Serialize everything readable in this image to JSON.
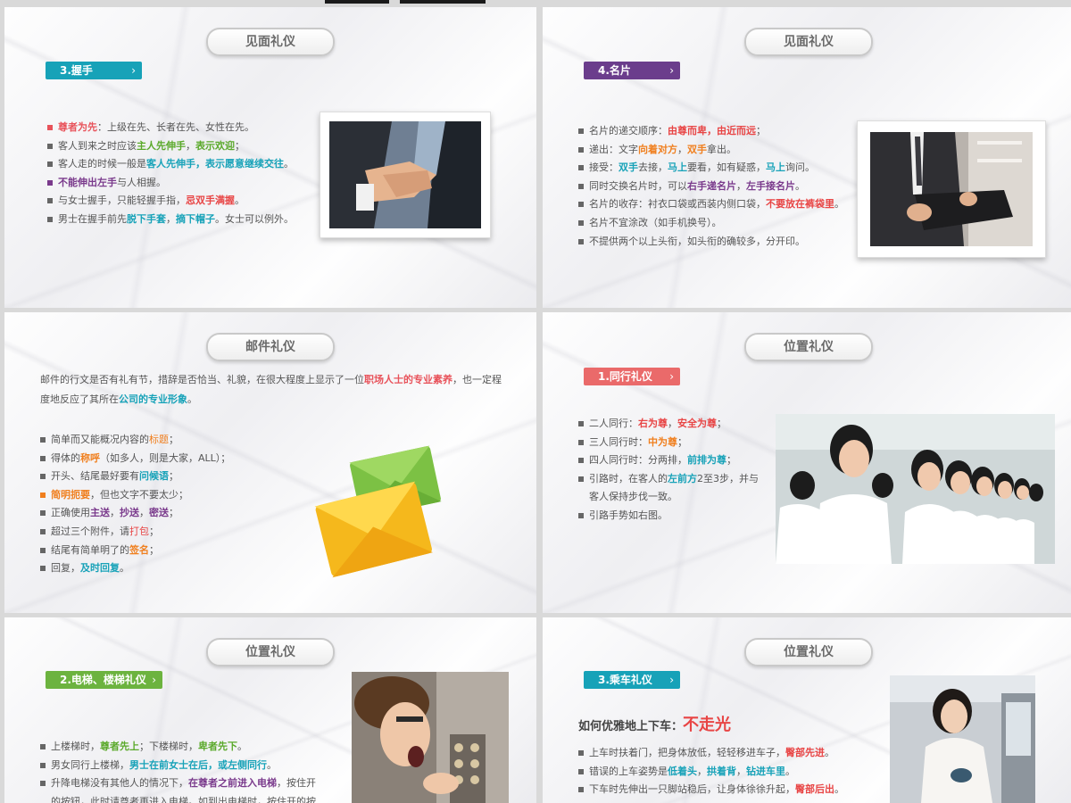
{
  "colors": {
    "teal": "#17a2b8",
    "purple": "#6b3d8c",
    "salmon": "#ea6a6a",
    "green": "#6cb33f",
    "red": "#e84545",
    "orange": "#f07f1e"
  },
  "slide1": {
    "title": "见面礼仪",
    "tag": "3.握手",
    "bullets": [
      {
        "pre": "",
        "hl1": "尊者为先",
        "mid": "：上级在先、长者在先、女性在先。",
        "hl2": "",
        "post": ""
      },
      {
        "pre": "客人到来之时应该",
        "hl1": "主人先伸手",
        "mid": "，",
        "hl2": "表示欢迎",
        "post": "；"
      },
      {
        "pre": "客人走的时候一般是",
        "hl1": "客人先伸手，表示愿意继续交往",
        "mid": "。",
        "hl2": "",
        "post": ""
      },
      {
        "pre": "",
        "hl1": "不能伸出左手",
        "mid": "与人相握。",
        "hl2": "",
        "post": ""
      },
      {
        "pre": "与女士握手，只能轻握手指，",
        "hl1": "忌双手满握",
        "mid": "。",
        "hl2": "",
        "post": ""
      },
      {
        "pre": "男士在握手前先",
        "hl1": "脱下手套",
        "mid": "，",
        "hl2": "摘下帽子",
        "post": "。女士可以例外。"
      }
    ],
    "image_icon": "handshake-photo"
  },
  "slide2": {
    "title": "见面礼仪",
    "tag": "4.名片",
    "bullets": [
      {
        "pre": "名片的递交顺序：",
        "hl1": "由尊而卑，由近而远",
        "mid": "；",
        "hl2": "",
        "post": ""
      },
      {
        "pre": "递出：文字",
        "hl1": "向着对方",
        "mid": "，",
        "hl2": "双手",
        "post": "拿出。"
      },
      {
        "pre": "接受：",
        "hl1": "双手",
        "mid": "去接，",
        "hl2": "马上",
        "post": "要看，如有疑惑，"
      },
      {
        "pre": "同时交换名片时，可以",
        "hl1": "右手递名片",
        "mid": "，",
        "hl2": "左手接名片",
        "post": "。"
      },
      {
        "pre": "名片的收存：衬衣口袋或西装内侧口袋，",
        "hl1": "不要放在裤袋里",
        "mid": "。",
        "hl2": "",
        "post": ""
      },
      {
        "pre": "名片不宜涂改（如手机换号）。",
        "hl1": "",
        "mid": "",
        "hl2": "",
        "post": ""
      },
      {
        "pre": "不提供两个以上头衔，如头衔的确较多，分开印。",
        "hl1": "",
        "mid": "",
        "hl2": "",
        "post": ""
      }
    ],
    "bullet3_tail_hl": "马上",
    "bullet3_tail_post": "询问。",
    "image_icon": "business-card-photo"
  },
  "slide3": {
    "title": "邮件礼仪",
    "para_pre": "邮件的行文是否有礼有节，措辞是否恰当、礼貌，在很大程度上显示了一位",
    "para_hl1": "职场人士的专业素养",
    "para_mid": "，也一定程度地反应了其所在",
    "para_hl2": "公司的专业形象",
    "para_post": "。",
    "bullets": [
      {
        "pre": "简单而又能概况内容的",
        "hl1": "标题",
        "mid": "；",
        "hl2": "",
        "post": ""
      },
      {
        "pre": "得体的",
        "hl1": "称呼",
        "mid": "（如多人，则是大家，ALL）；",
        "hl2": "",
        "post": ""
      },
      {
        "pre": "开头、结尾最好要有",
        "hl1": "问候语",
        "mid": "；",
        "hl2": "",
        "post": ""
      },
      {
        "pre": "",
        "hl1": "简明扼要",
        "mid": "，但也文字不要太少；",
        "hl2": "",
        "post": ""
      },
      {
        "pre": "正确使用",
        "hl1": "主送",
        "mid": "，",
        "hl2": "抄送",
        "post": "，"
      },
      {
        "pre": "超过三个附件，请",
        "hl1": "打包",
        "mid": "；",
        "hl2": "",
        "post": ""
      },
      {
        "pre": "结尾有简单明了的",
        "hl1": "签名",
        "mid": "；",
        "hl2": "",
        "post": ""
      },
      {
        "pre": "回复，",
        "hl1": "及时回复",
        "mid": "。",
        "hl2": "",
        "post": ""
      }
    ],
    "bullet5_tail_hl": "密送",
    "bullet5_tail_post": "；",
    "image_icon": "envelope-icon"
  },
  "slide4": {
    "title": "位置礼仪",
    "tag": "1.同行礼仪",
    "bullets": [
      {
        "pre": "二人同行：",
        "hl1": "右为尊",
        "mid": "，",
        "hl2": "安全为尊",
        "post": "；"
      },
      {
        "pre": "三人同行时：",
        "hl1": "中为尊",
        "mid": "；",
        "hl2": "",
        "post": ""
      },
      {
        "pre": "四人同行时：分两排，",
        "hl1": "前排为尊",
        "mid": "；",
        "hl2": "",
        "post": ""
      },
      {
        "pre": "引路时，在客人的",
        "hl1": "左前方",
        "mid": "2至3步，并与",
        "hl2": "",
        "post": ""
      },
      {
        "pre": "引路手势如右图。",
        "hl1": "",
        "mid": "",
        "hl2": "",
        "post": ""
      }
    ],
    "bullet4_cont": "客人保持步伐一致。",
    "image_icon": "hostesses-photo"
  },
  "slide5": {
    "title": "位置礼仪",
    "tag": "2.电梯、楼梯礼仪",
    "bullets": [
      {
        "pre": "上楼梯时，",
        "hl1": "尊者先上",
        "mid": "；下楼梯时，",
        "hl2": "卑者先下",
        "post": "。"
      },
      {
        "pre": "男女同行上楼梯，",
        "hl1": "男士在前女士在后，或左侧同行",
        "mid": "。",
        "hl2": "",
        "post": ""
      },
      {
        "pre": "升降电梯没有其他人的情况下，",
        "hl1": "在尊者之前进入电梯",
        "mid": "，按住开",
        "hl2": "",
        "post": ""
      }
    ],
    "bullet3_cont": "的按钮，此时请尊者再进入电梯。如到出电梯时，按住开的按",
    "image_icon": "elevator-photo"
  },
  "slide6": {
    "title": "位置礼仪",
    "tag": "3.乘车礼仪",
    "heading": "如何优雅地上下车：",
    "heading_hl": "不走光",
    "bullets": [
      {
        "pre": "上车时扶着门，把身体放低，轻轻移进车子，",
        "hl1": "臀部先进",
        "mid": "。",
        "hl2": "",
        "post": ""
      },
      {
        "pre": "错误的上车姿势是",
        "hl1": "低着头",
        "mid": "，",
        "hl2": "拱着背",
        "post": "，"
      },
      {
        "pre": "下车时先伸出一只脚站稳后，让身体徐徐升起，",
        "hl1": "臀部后出",
        "mid": "。",
        "hl2": "",
        "post": ""
      }
    ],
    "bullet2_tail_hl": "钻进车里",
    "bullet2_tail_post": "。",
    "image_icon": "car-woman-photo"
  }
}
